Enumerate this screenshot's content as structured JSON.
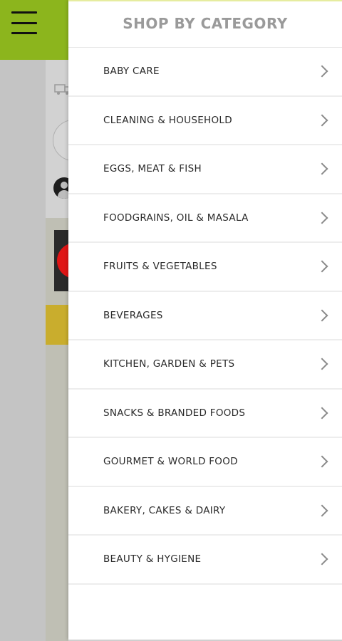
{
  "drawer": {
    "title": "SHOP BY CATEGORY",
    "categories": [
      {
        "label": "BABY CARE"
      },
      {
        "label": "CLEANING & HOUSEHOLD"
      },
      {
        "label": "EGGS, MEAT & FISH"
      },
      {
        "label": "FOODGRAINS, OIL & MASALA"
      },
      {
        "label": "FRUITS & VEGETABLES"
      },
      {
        "label": "BEVERAGES"
      },
      {
        "label": "KITCHEN, GARDEN & PETS"
      },
      {
        "label": "SNACKS & BRANDED FOODS"
      },
      {
        "label": "GOURMET & WORLD FOOD"
      },
      {
        "label": "BAKERY, CAKES & DAIRY"
      },
      {
        "label": "BEAUTY & HYGIENE"
      }
    ]
  },
  "icons": {
    "menu": "hamburger-menu-icon",
    "chevron": "chevron-right-icon",
    "truck": "delivery-truck-icon",
    "user": "user-icon"
  },
  "colors": {
    "header": "#8cb51d",
    "drawer_bg": "#ffffff",
    "title_text": "#9a9a9a",
    "item_text": "#2a2a2a"
  }
}
